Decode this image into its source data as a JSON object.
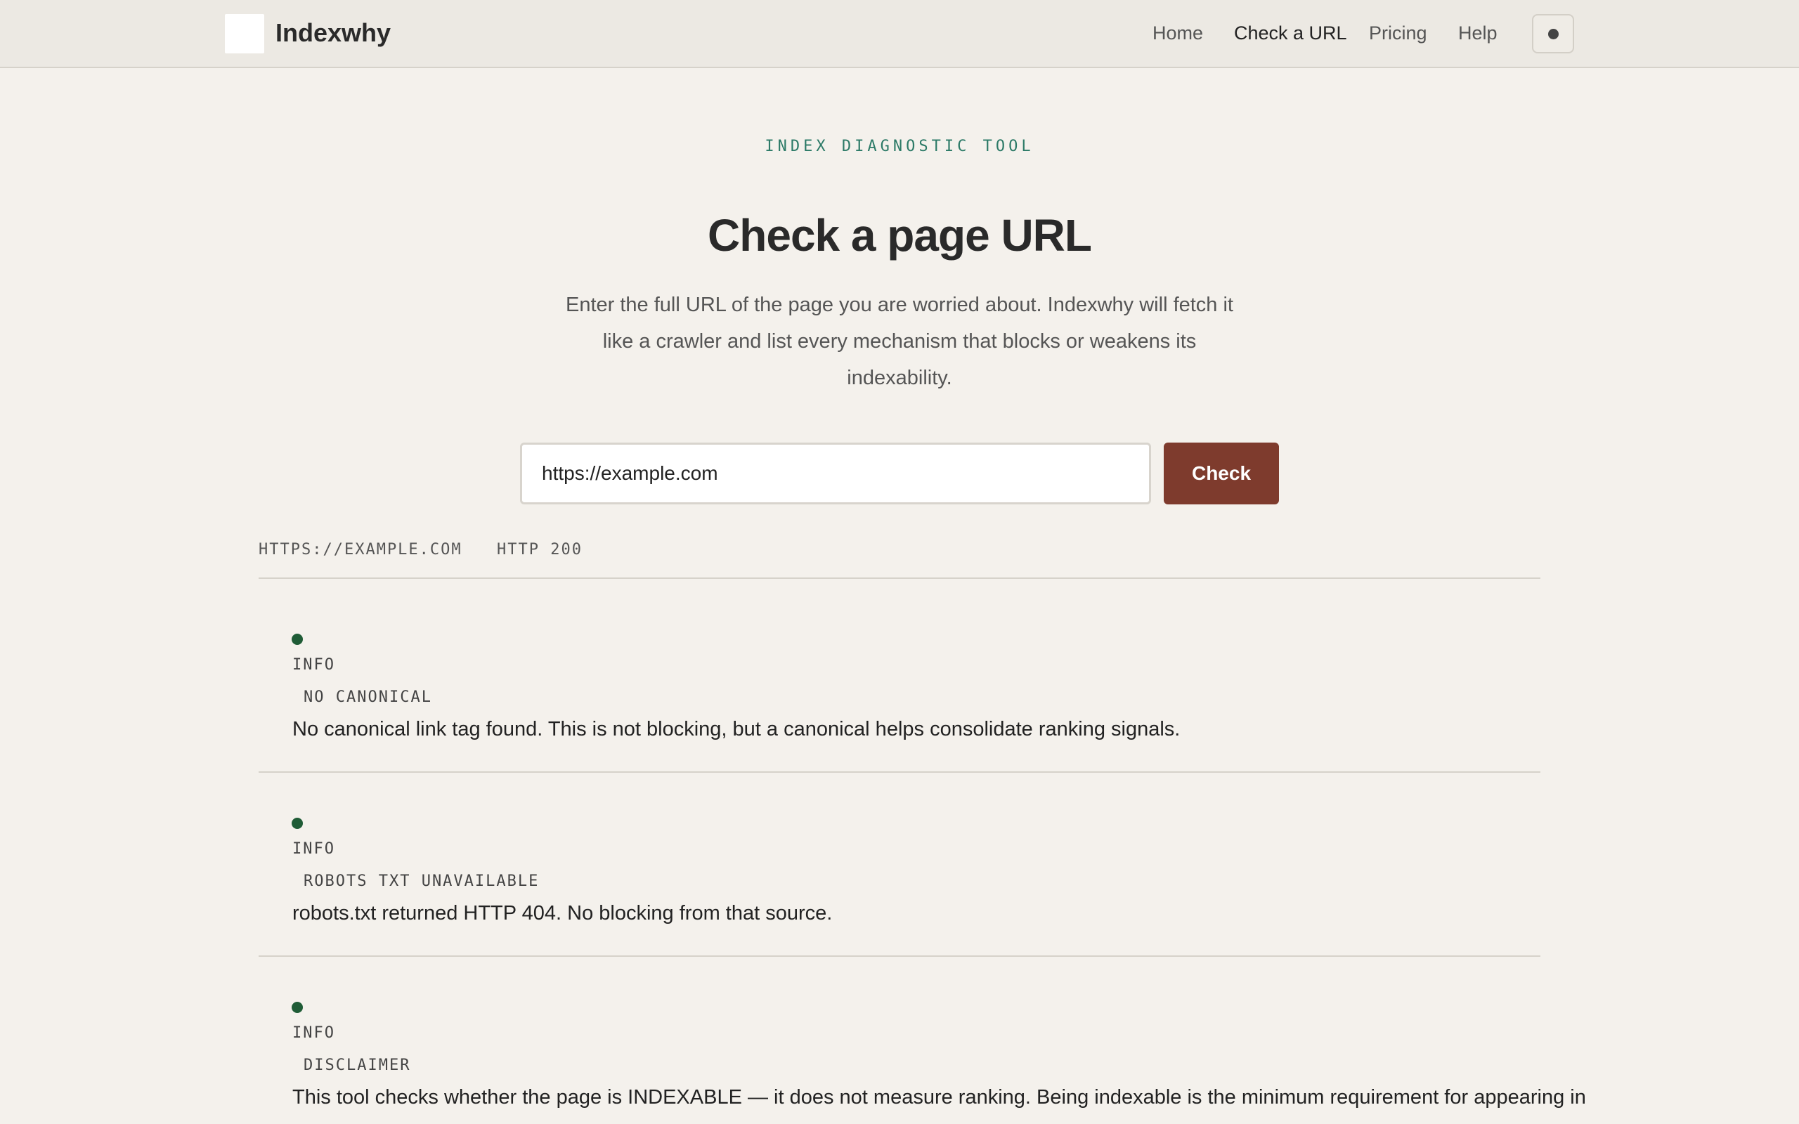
{
  "header": {
    "brand": "Indexwhy",
    "nav": [
      "Home",
      "Check a URL",
      "Pricing",
      "Help"
    ],
    "active_nav": "Check a URL",
    "theme_icon": "dot-icon"
  },
  "hero": {
    "eyebrow": "INDEX DIAGNOSTIC TOOL",
    "title": "Check a page URL",
    "intro": "Enter the full URL of the page you are worried about. Indexwhy will fetch it like a crawler and list every mechanism that blocks or weakens its indexability."
  },
  "form": {
    "url_value": "https://example.com",
    "submit_label": "Check"
  },
  "result": {
    "checked_url": "HTTPS://EXAMPLE.COM",
    "status": "HTTP 200"
  },
  "findings": [
    {
      "severity": "INFO",
      "code": "NO CANONICAL",
      "message": "No canonical link tag found. This is not blocking, but a canonical helps consolidate ranking signals.",
      "color": "#1f5c36"
    },
    {
      "severity": "INFO",
      "code": "ROBOTS TXT UNAVAILABLE",
      "message": "robots.txt returned HTTP 404. No blocking from that source.",
      "color": "#1f5c36"
    },
    {
      "severity": "INFO",
      "code": "DISCLAIMER",
      "message": "This tool checks whether the page is INDEXABLE — it does not measure ranking. Being indexable is the minimum requirement for appearing in",
      "color": "#1f5c36"
    }
  ],
  "colors": {
    "accent": "#7e3b2d",
    "eyebrow": "#2c7a67",
    "info_dot": "#1f5c36",
    "background": "#f4f1ec"
  }
}
